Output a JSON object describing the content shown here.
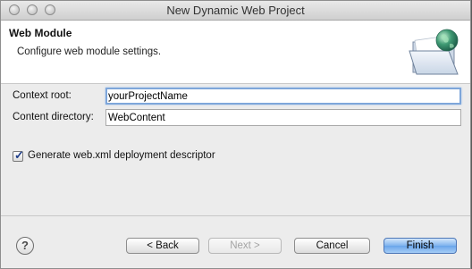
{
  "window": {
    "title": "New Dynamic Web Project"
  },
  "header": {
    "title": "Web Module",
    "description": "Configure web module settings."
  },
  "form": {
    "context_root": {
      "label": "Context root:",
      "value": "yourProjectName"
    },
    "content_directory": {
      "label": "Content directory:",
      "value": "WebContent"
    },
    "generate_descriptor": {
      "label": "Generate web.xml deployment descriptor",
      "checked": true
    }
  },
  "footer": {
    "help_glyph": "?",
    "back_label": "< Back",
    "next_label": "Next >",
    "cancel_label": "Cancel",
    "finish_label": "Finish"
  },
  "colors": {
    "default_button": "#6aa5ea",
    "focus_ring": "#7ea6da",
    "selection": "#b5d5ff"
  },
  "icons": {
    "wizard_banner": "folder-globe-icon",
    "help": "help-icon"
  }
}
